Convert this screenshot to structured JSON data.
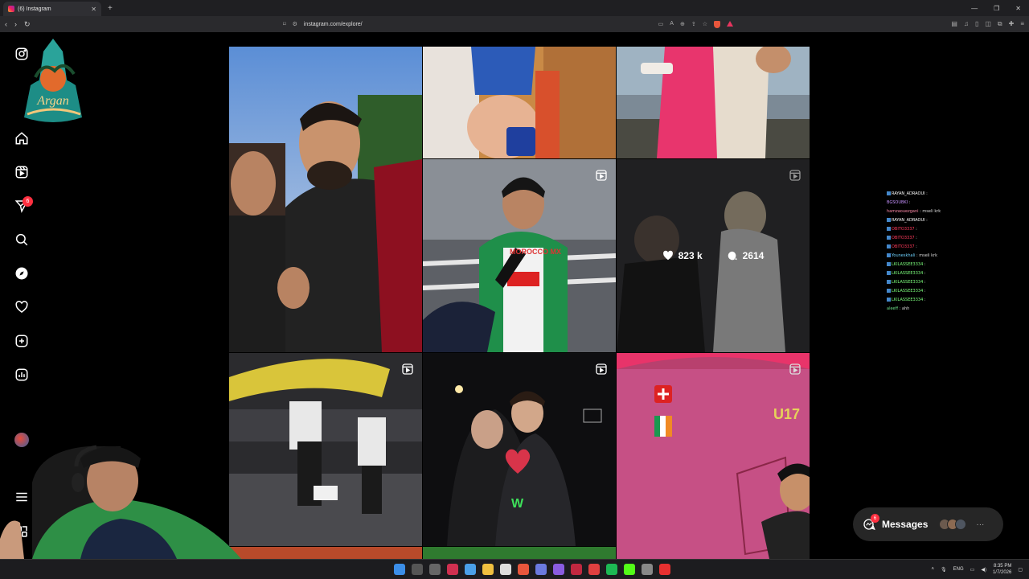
{
  "browser": {
    "tab_title": "(6) Instagram",
    "url": "instagram.com/explore/",
    "lang": "ENG"
  },
  "sidebar": {
    "notifications_badge": "6",
    "items": [
      "instagram-logo",
      "home",
      "reels",
      "messages",
      "search",
      "explore",
      "notifications",
      "create",
      "dashboard",
      "profile",
      "more",
      "threads"
    ]
  },
  "grid": {
    "hover_tile": {
      "likes": "823 k",
      "comments": "2614"
    }
  },
  "chat": [
    {
      "user": "RAYAN_ADRAOUI",
      "msg": " : ",
      "color": "#ffffff",
      "badge": true
    },
    {
      "user": "BGSOUBKI",
      "msg": " : ",
      "color": "#c792ff",
      "badge": false
    },
    {
      "user": "hamzaouezgani",
      "msg": " : mseli krk",
      "color": "#ff8aa8",
      "badge": false
    },
    {
      "user": "RAYAN_ADRAOUI",
      "msg": " : ",
      "color": "#ffffff",
      "badge": true
    },
    {
      "user": "OBITO3337",
      "msg": " : ",
      "color": "#ff3b5c",
      "badge": true
    },
    {
      "user": "OBITO3337",
      "msg": " : ",
      "color": "#ff3b5c",
      "badge": true
    },
    {
      "user": "OBITO3337",
      "msg": " : ",
      "color": "#ff3b5c",
      "badge": true
    },
    {
      "user": "Youneskhali",
      "msg": " : mseli krk",
      "color": "#6fd3ff",
      "badge": true
    },
    {
      "user": "LKILASSEE3334",
      "msg": " : ",
      "color": "#7dff7d",
      "badge": true
    },
    {
      "user": "LKILASSEE3334",
      "msg": " : ",
      "color": "#7dff7d",
      "badge": true
    },
    {
      "user": "LKILASSEE3334",
      "msg": " : ",
      "color": "#7dff7d",
      "badge": true
    },
    {
      "user": "LKILASSEE3334",
      "msg": " : ",
      "color": "#7dff7d",
      "badge": true
    },
    {
      "user": "LKILASSEE3334",
      "msg": " : ",
      "color": "#7dff7d",
      "badge": true
    },
    {
      "user": "aleeff",
      "msg": " : ahh",
      "color": "#6fe28a",
      "badge": false
    }
  ],
  "messages": {
    "label": "Messages",
    "badge": "6"
  },
  "taskbar": {
    "time": "8:35 PM",
    "date": "1/7/2026"
  },
  "tile_texts": {
    "mic_brand": "MOROCCO MX",
    "jersey_letter": "W",
    "u17": "U17"
  },
  "colors": {
    "accent_red": "#ff3040",
    "bg": "#000000"
  }
}
